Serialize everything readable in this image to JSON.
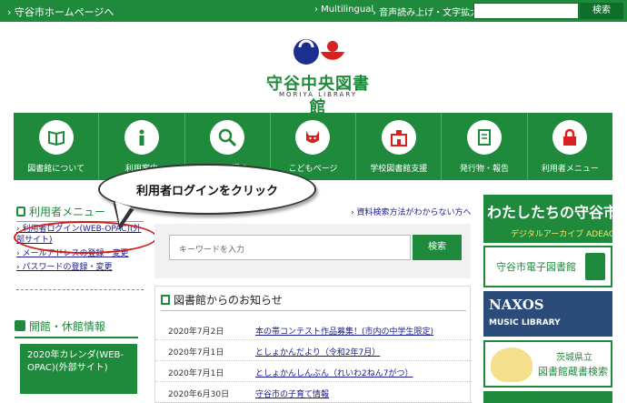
{
  "topbar": {
    "home_link": "› 守谷市ホームページへ",
    "multilingual": "› Multilingual",
    "voice": "› 音声読み上げ・文字拡大",
    "search_placeholder": "",
    "search_button": "検索"
  },
  "logo": {
    "title": "守谷中央図書館",
    "subtitle": "MORIYA LIBRARY"
  },
  "nav": [
    {
      "label": "図書館について",
      "icon": "book-icon"
    },
    {
      "label": "利用案内",
      "icon": "info-icon"
    },
    {
      "label": "資料を探す",
      "icon": "magnifier-icon"
    },
    {
      "label": "こどもページ",
      "icon": "cat-icon"
    },
    {
      "label": "学校図書館支援",
      "icon": "school-icon"
    },
    {
      "label": "発行物・報告",
      "icon": "document-icon"
    },
    {
      "label": "利用者メニュー",
      "icon": "lock-icon"
    }
  ],
  "callout": {
    "text": "利用者ログインをクリック"
  },
  "user_menu": {
    "heading": "利用者メニュー",
    "items": [
      "利用者ログイン(WEB-OPAC)(外部サイト)",
      "メールアドレスの登録・変更",
      "パスワードの登録・変更"
    ]
  },
  "opening": {
    "heading": "開館・休館情報",
    "calendar": "2020年カレンダ(WEB-OPAC)(外部サイト)"
  },
  "search": {
    "help_link": "› 資料検索方法がわからない方へ",
    "placeholder": "キーワードを入力",
    "button": "検索"
  },
  "news": {
    "heading": "図書館からのお知らせ",
    "rows": [
      {
        "date": "2020年7月2日",
        "title": "本の帯コンテスト作品募集！(市内の中学生限定)"
      },
      {
        "date": "2020年7月1日",
        "title": "としょかんだより（令和2年7月）"
      },
      {
        "date": "2020年7月1日",
        "title": "としょかんしんぶん（れいわ2ねん7がつ）"
      },
      {
        "date": "2020年6月30日",
        "title": "守谷市の子育て情報"
      }
    ]
  },
  "banners": {
    "archive_title": "わたしたちの守谷市",
    "archive_sub": "デジタルアーカイブ ADEAC",
    "ebook": "守谷市電子図書館",
    "naxos_title": "NAXOS",
    "naxos_sub": "MUSIC LIBRARY",
    "ibaraki_1": "茨城県立",
    "ibaraki_2": "図書館蔵書検索"
  },
  "colors": {
    "brand_green": "#1f8a3c",
    "link_blue": "#1a1a8a",
    "highlight_red": "#d21b1b"
  }
}
